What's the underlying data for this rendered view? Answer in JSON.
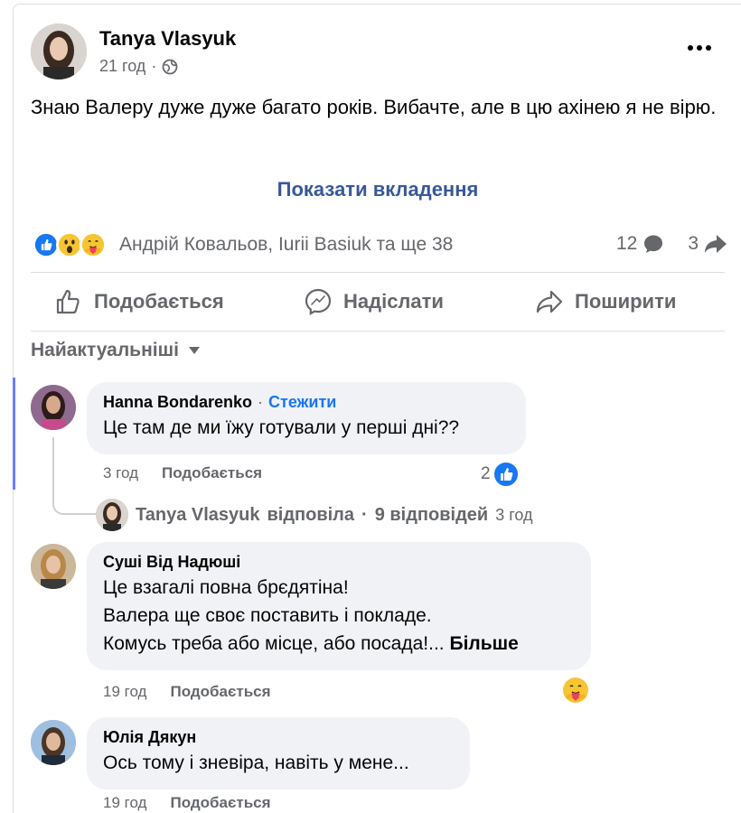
{
  "post": {
    "author": "Tanya Vlasyuk",
    "time": "21 год",
    "separator": "·",
    "text": "Знаю Валеру дуже дуже багато років. Вибачте, але в цю ахінею  я не вірю.",
    "show_attachments": "Показати вкладення",
    "reactors": "Андрій Ковальов, Iurii Basiuk та ще 38",
    "comment_count": "12",
    "share_count": "3",
    "reaction_icons": [
      "like-reaction",
      "wow-reaction",
      "care-reaction"
    ]
  },
  "actions": {
    "like": "Подобається",
    "send": "Надіслати",
    "share": "Поширити"
  },
  "sort_label": "Найактуальніші",
  "comments": [
    {
      "name": "Hanna Bondarenko",
      "follow": "Стежити",
      "separator": "·",
      "text": "Це там де ми їжу готували у перші дні??",
      "time": "3 год",
      "like": "Подобається",
      "reactions": "2"
    },
    {
      "name": "Суші Від Надюші",
      "lines": [
        "Це взагалі повна брєдятіна!",
        "Валера ще своє поставить і покладе.",
        "Комусь треба або місце, або посада!..."
      ],
      "more": "Більше",
      "time": "19 год",
      "like": "Подобається"
    },
    {
      "name": "Юлія Дякун",
      "text": "Ось тому і зневіра, навіть у мене...",
      "time": "19 год",
      "like": "Подобається"
    }
  ],
  "reply": {
    "name": "Tanya Vlasyuk",
    "verb": "відповіла",
    "separator": "·",
    "count": "9 відповідей",
    "time": "3 год"
  },
  "colors": {
    "link": "#385898",
    "follow": "#1877f2",
    "secondary_text": "#65676b",
    "bubble": "#f0f2f5",
    "thread_bar": "#6d7cff"
  }
}
